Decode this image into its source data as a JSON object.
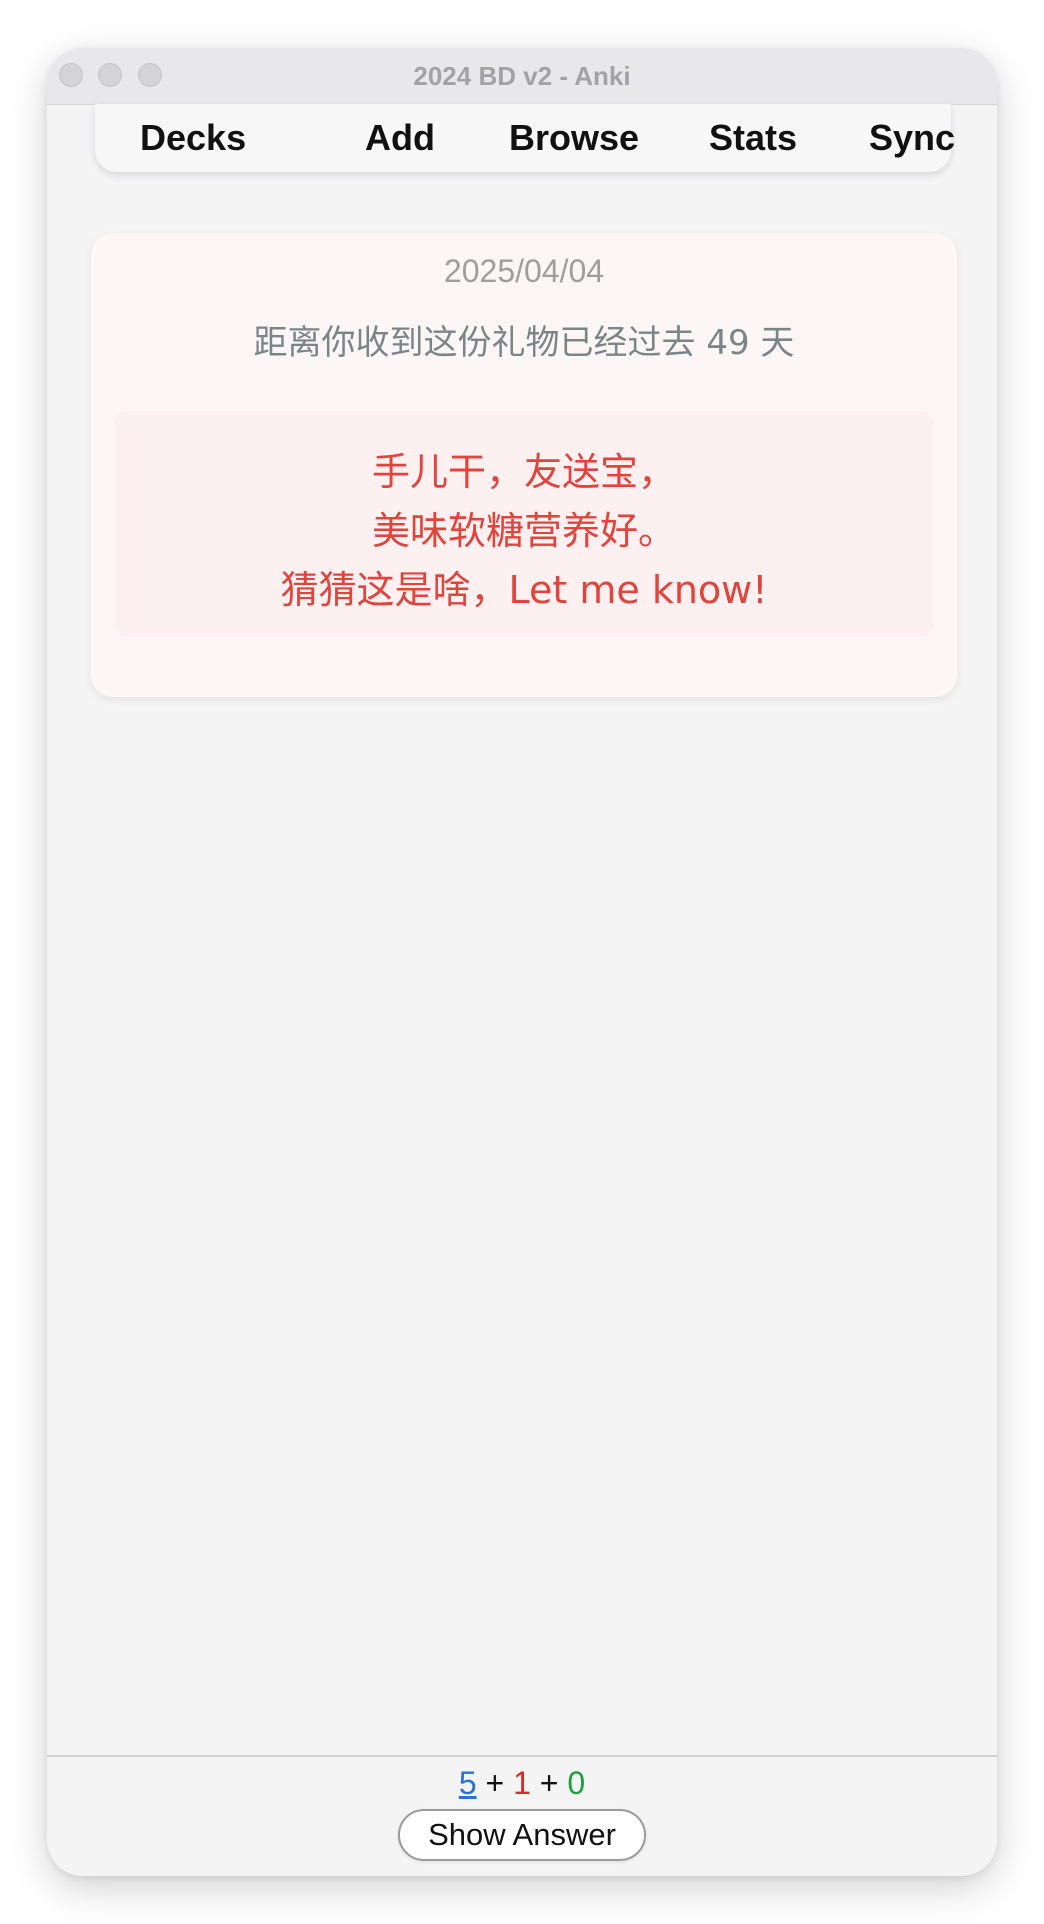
{
  "window": {
    "title": "2024 BD v2 - Anki"
  },
  "toolbar": {
    "items": [
      {
        "label": "Decks"
      },
      {
        "label": "Add"
      },
      {
        "label": "Browse"
      },
      {
        "label": "Stats"
      },
      {
        "label": "Sync"
      }
    ]
  },
  "card": {
    "date": "2025/04/04",
    "days_text": "距离你收到这份礼物已经过去 49 天",
    "riddle_lines": [
      "手儿干，友送宝，",
      "美味软糖营养好。",
      "猜猜这是啥，Let me know!"
    ]
  },
  "bottom": {
    "counts": {
      "new": "5",
      "learn": "1",
      "review": "0",
      "separator": "+"
    },
    "show_answer_label": "Show Answer"
  },
  "colors": {
    "new_count": "#2f6fd8",
    "learn_count": "#d42a2a",
    "review_count": "#1f9e3c",
    "riddle_text": "#e0443c",
    "card_background": "#fdf6f6"
  },
  "icons": {
    "window_controls": [
      "close-button-icon",
      "minimize-button-icon",
      "zoom-button-icon"
    ]
  }
}
